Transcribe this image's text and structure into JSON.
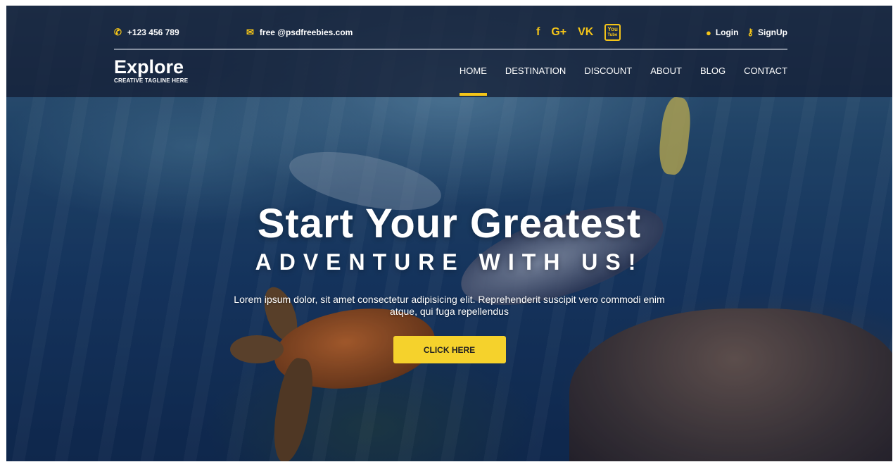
{
  "topbar": {
    "phone": "+123 456 789",
    "email": "free @psdfreebies.com",
    "social": {
      "facebook": "f",
      "googleplus": "G+",
      "vk": "VK",
      "youtube_top": "You",
      "youtube_bottom": "Tube"
    },
    "login": "Login",
    "signup": "SignUp"
  },
  "brand": {
    "title": "Explore",
    "tagline": "CREATIVE TAGLINE HERE"
  },
  "nav": {
    "items": [
      "HOME",
      "DESTINATION",
      "DISCOUNT",
      "ABOUT",
      "BLOG",
      "CONTACT"
    ],
    "active": "HOME"
  },
  "hero": {
    "headline": "Start Your Greatest",
    "subheadline": "ADVENTURE WITH US!",
    "description": "Lorem ipsum dolor, sit amet consectetur adipisicing elit. Reprehenderit suscipit vero commodi enim atque, qui fuga repellendus",
    "button": "CLICK HERE"
  },
  "icons": {
    "phone": "phone-icon",
    "email": "mail-icon",
    "user": "user-icon",
    "key": "key-icon"
  },
  "colors": {
    "accent": "#f5c518",
    "button": "#f5d22c",
    "header_bg": "#121a30"
  }
}
